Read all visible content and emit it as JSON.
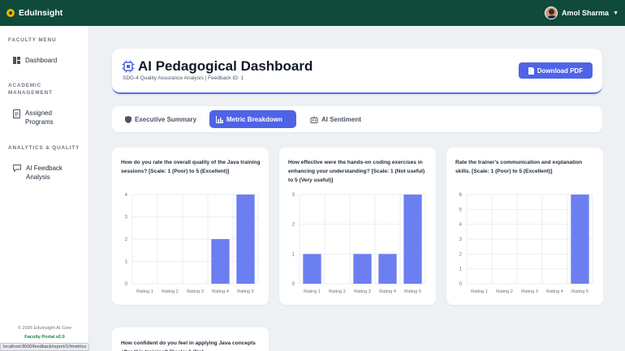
{
  "topbar": {
    "brand": "EduInsight",
    "user_name": "Amol Sharma"
  },
  "sidebar": {
    "sections": [
      {
        "title": "FACULTY MENU",
        "items": [
          {
            "label": "Dashboard",
            "icon": "dashboard-icon"
          }
        ]
      },
      {
        "title": "ACADEMIC MANAGEMENT",
        "items": [
          {
            "label": "Assigned Programs",
            "icon": "document-icon"
          }
        ]
      },
      {
        "title": "ANALYTICS & QUALITY",
        "items": [
          {
            "label": "AI Feedback Analysis",
            "icon": "chat-icon"
          }
        ]
      }
    ],
    "footer_copyright": "© 2026 EduInsight AI Core",
    "footer_version": "Faculty Portal v2.0"
  },
  "header": {
    "title": "AI Pedagogical Dashboard",
    "subtitle": "SDG-4 Quality Assurance Analysis | Feedback ID: 1",
    "download_label": "Download PDF"
  },
  "tabs": [
    {
      "label": "Executive Summary",
      "icon": "shield-icon",
      "active": false
    },
    {
      "label": "Metric Breakdown",
      "icon": "bar-chart-icon",
      "active": true
    },
    {
      "label": "AI Sentiment",
      "icon": "robot-icon",
      "active": false
    }
  ],
  "colors": {
    "accent": "#4f63e7",
    "bar": "#6b7ff0",
    "topbar": "#0f4a3b"
  },
  "chart_data": [
    {
      "type": "bar",
      "title": "How do you rate the overall quality of the Java training sessions? [Scale: 1 (Poor) to 5 (Excellent)]",
      "categories": [
        "Rating 1",
        "Rating 2",
        "Rating 3",
        "Rating 4",
        "Rating 5"
      ],
      "values": [
        0,
        0,
        0,
        2,
        4
      ],
      "ylim": [
        0,
        4
      ],
      "yticks": [
        0,
        1,
        2,
        3,
        4
      ]
    },
    {
      "type": "bar",
      "title": "How effective were the hands-on coding exercises in enhancing your understanding? [Scale: 1 (Not useful) to 5 (Very useful)]",
      "categories": [
        "Rating 1",
        "Rating 2",
        "Rating 3",
        "Rating 4",
        "Rating 5"
      ],
      "values": [
        1,
        0,
        1,
        1,
        3
      ],
      "ylim": [
        0,
        3
      ],
      "yticks": [
        0,
        1,
        2,
        3
      ]
    },
    {
      "type": "bar",
      "title": "Rate the trainer's communication and explanation skills. [Scale: 1 (Poor) to 5 (Excellent)]",
      "categories": [
        "Rating 1",
        "Rating 2",
        "Rating 3",
        "Rating 4",
        "Rating 5"
      ],
      "values": [
        0,
        0,
        0,
        0,
        6
      ],
      "ylim": [
        0,
        6
      ],
      "yticks": [
        0,
        1,
        2,
        3,
        4,
        5,
        6
      ]
    }
  ],
  "bottom_card": {
    "question": "How confident do you feel in applying Java concepts after this training? [Scale: 1 (Not"
  },
  "status_url": "localhost:8000/feedback/report/1/#metrics"
}
